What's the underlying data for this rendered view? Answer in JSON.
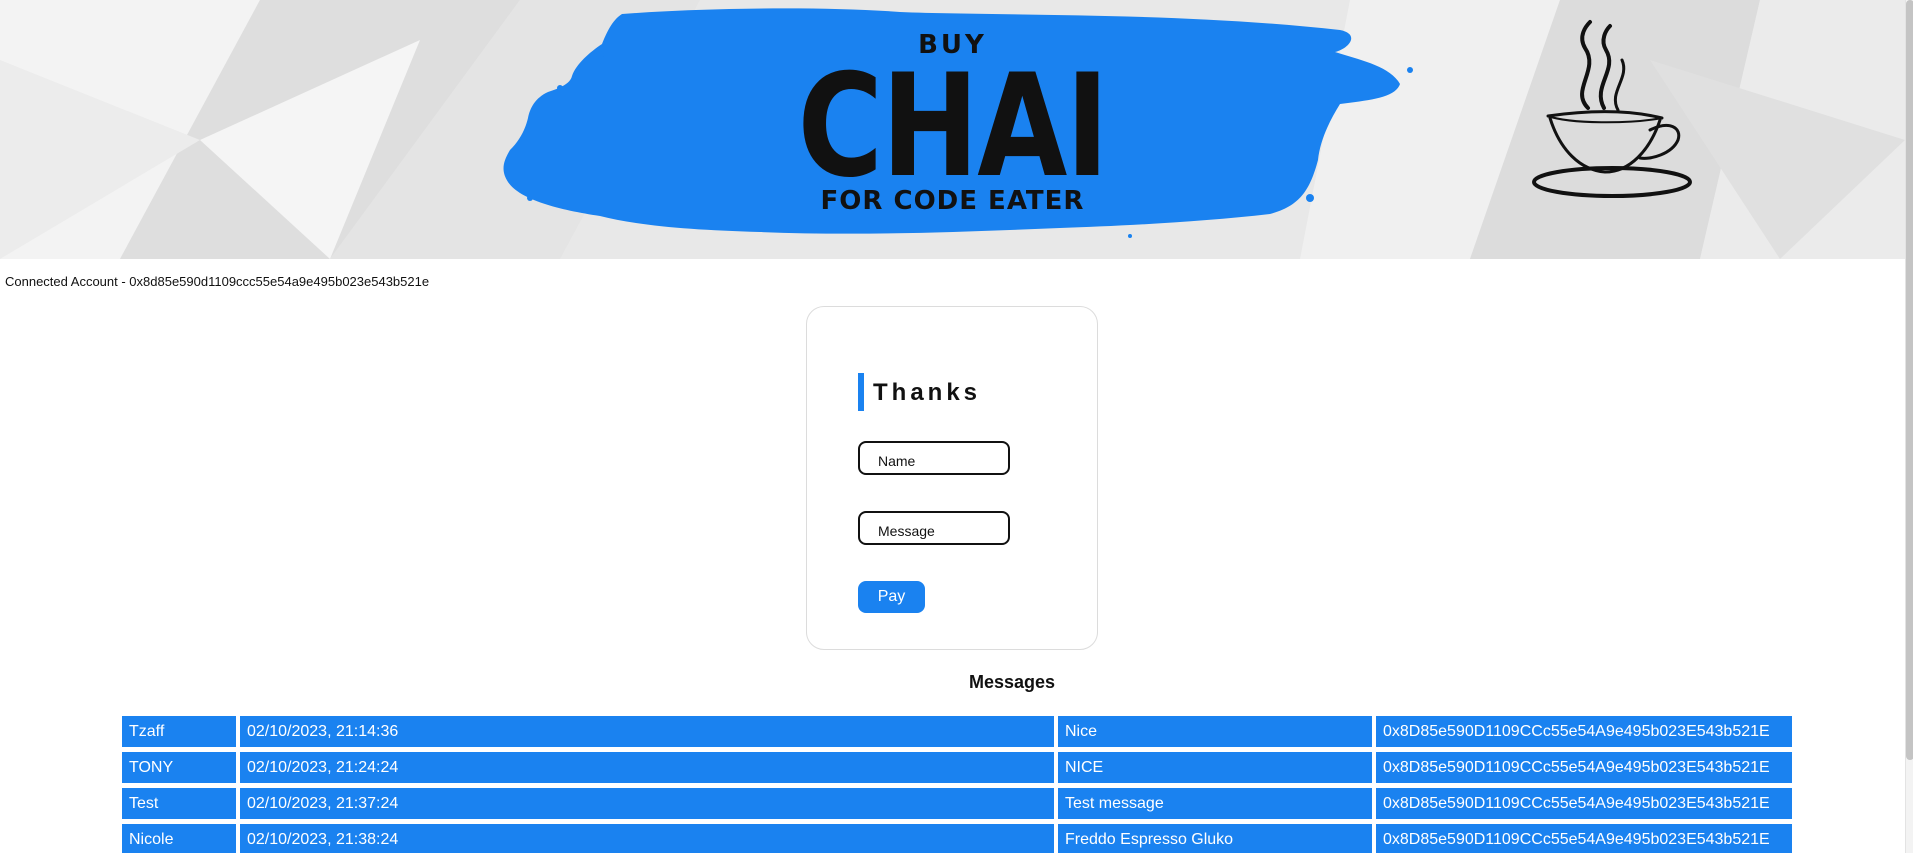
{
  "banner": {
    "buy": "BUY",
    "chai": "CHAI",
    "subtitle": "FOR CODE EATER",
    "accent_color": "#1a82f0"
  },
  "account": {
    "text": "Connected Account - 0x8d85e590d1109ccc55e54a9e495b023e543b521e"
  },
  "form": {
    "title": "Thanks",
    "name_placeholder": "Name",
    "message_placeholder": "Message",
    "pay_label": "Pay"
  },
  "messages": {
    "heading": "Messages",
    "rows": [
      {
        "name": "Tzaff",
        "time": "02/10/2023, 21:14:36",
        "message": "Nice",
        "address": "0x8D85e590D1109CCc55e54A9e495b023E543b521E"
      },
      {
        "name": "TONY",
        "time": "02/10/2023, 21:24:24",
        "message": "NICE",
        "address": "0x8D85e590D1109CCc55e54A9e495b023E543b521E"
      },
      {
        "name": "Test",
        "time": "02/10/2023, 21:37:24",
        "message": "Test message",
        "address": "0x8D85e590D1109CCc55e54A9e495b023E543b521E"
      },
      {
        "name": "Nicole",
        "time": "02/10/2023, 21:38:24",
        "message": "Freddo Espresso Gluko",
        "address": "0x8D85e590D1109CCc55e54A9e495b023E543b521E"
      }
    ]
  }
}
